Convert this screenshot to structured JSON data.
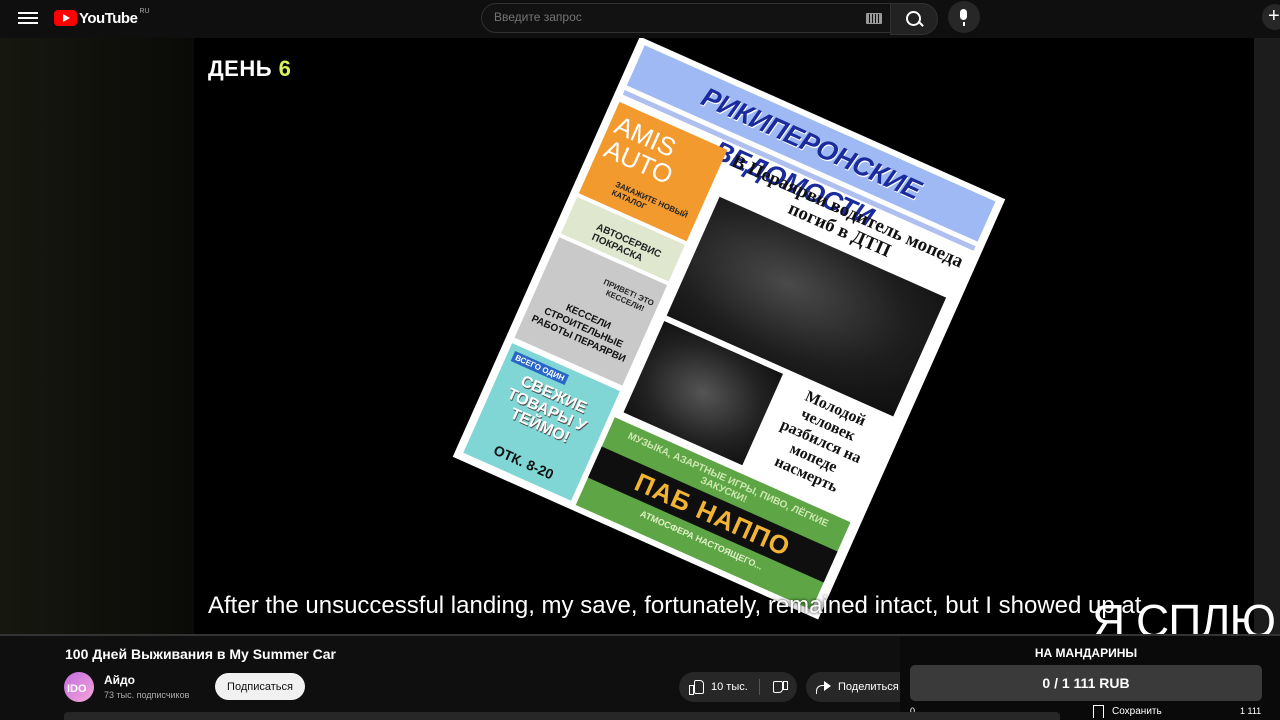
{
  "header": {
    "logo_text": "YouTube",
    "logo_region": "RU",
    "search_placeholder": "Введите запрос",
    "icons": [
      "menu-icon",
      "keyboard-icon",
      "search-icon",
      "mic-icon",
      "create-icon"
    ]
  },
  "player": {
    "day_label": "ДЕНЬ",
    "day_number": "6",
    "newspaper": {
      "masthead": "РИКИПЕРОНСКИЕ ВЕДОМОСТИ",
      "ad_orange": "AMIS AUTO",
      "ad_orange_small": "ЗАКАЖИТЕ НОВЫЙ КАТАЛОГ",
      "ad_service": "АВТОСЕРВИС ПОКРАСКА",
      "ad_gray_greeting": "ПРИВЕТ! ЭТО КЕССЕЛИ!",
      "ad_gray_text": "КЕССЕЛИ СТРОИТЕЛЬНЫЕ РАБОТЫ ПЕРАЯРВИ",
      "ad_teal_tag": "ВСЕГО ОДИН",
      "ad_teal_text": "СВЕЖИЕ ТОВАРЫ У ТЕЙМО!",
      "ad_teal_hours": "ОТК. 8-20",
      "headline": "В Пераярви водитель мопеда погиб в ДТП",
      "sub_headline": "Молодой человек разбился на мопеде насмерть",
      "pub_top": "МУЗЫКА, АЗАРТНЫЕ ИГРЫ, ПИВО, ЛЁГКИЕ ЗАКУСКИ!",
      "pub_name": "ПАБ НАППО",
      "pub_bottom": "АТМОСФЕРА НАСТОЯЩЕГО..."
    },
    "subtitle": "After the unsuccessful landing, my save, fortunately, remained intact, but I showed up at",
    "overlay_text": "Я СПЛЮ"
  },
  "video": {
    "title": "100 Дней Выживания в My Summer Car",
    "channel_name": "Айдо",
    "channel_avatar_text": "IDO",
    "subscribers": "73 тыс. подписчиков",
    "subscribe_label": "Подписаться",
    "likes": "10 тыс.",
    "share_label": "Поделиться",
    "save_label": "Сохранить"
  },
  "donation": {
    "title": "НА МАНДАРИНЫ",
    "amount": "0 / 1 111 RUB",
    "min": "0",
    "max": "1 111"
  }
}
